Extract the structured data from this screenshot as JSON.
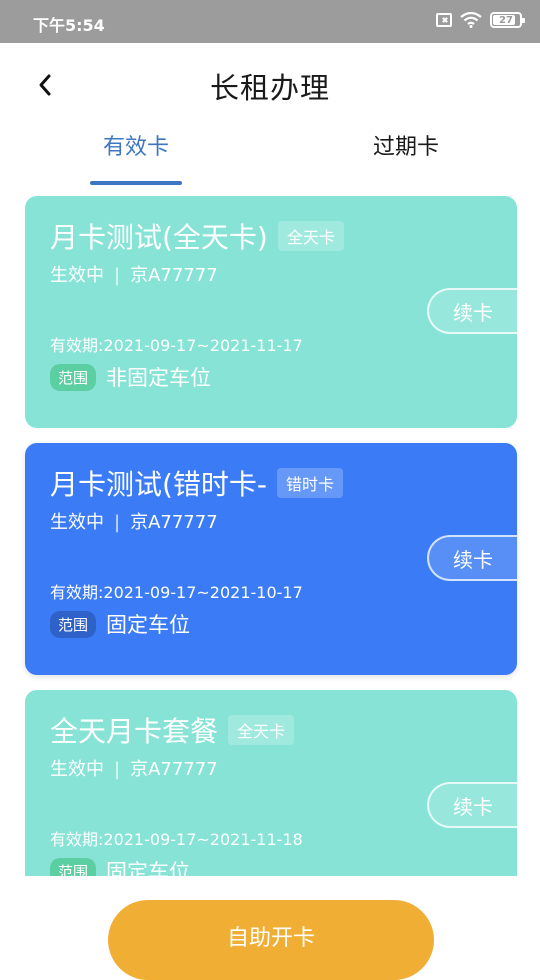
{
  "status_bar": {
    "time": "下午5:54",
    "battery": "27",
    "icons": [
      "sim-off-icon",
      "wifi-icon",
      "battery-icon"
    ]
  },
  "header": {
    "title": "长租办理",
    "back_icon": "chevron-left-icon"
  },
  "tabs": [
    {
      "label": "有效卡",
      "active": true
    },
    {
      "label": "过期卡",
      "active": false
    }
  ],
  "cards": [
    {
      "name": "月卡测试(全天卡)",
      "tag": "全天卡",
      "status": "生效中",
      "plate": "京A77777",
      "validity": "有效期:2021-09-17~2021-11-17",
      "scope_label": "范围",
      "scope_value": "非固定车位",
      "renew_label": "续卡",
      "color": "#86e3d6"
    },
    {
      "name": "月卡测试(错时卡-",
      "tag": "错时卡",
      "status": "生效中",
      "plate": "京A77777",
      "validity": "有效期:2021-09-17~2021-10-17",
      "scope_label": "范围",
      "scope_value": "固定车位",
      "renew_label": "续卡",
      "color": "#3b7cf6"
    },
    {
      "name": "全天月卡套餐",
      "tag": "全天卡",
      "status": "生效中",
      "plate": "京A77777",
      "validity": "有效期:2021-09-17~2021-11-18",
      "scope_label": "范围",
      "scope_value": "固定车位",
      "renew_label": "续卡",
      "color": "#86e3d6"
    }
  ],
  "bottom": {
    "open_card_label": "自助开卡",
    "color": "#f1ae35"
  },
  "colors": {
    "accent": "#3d76c2",
    "status_bar": "#9c9c9c"
  }
}
